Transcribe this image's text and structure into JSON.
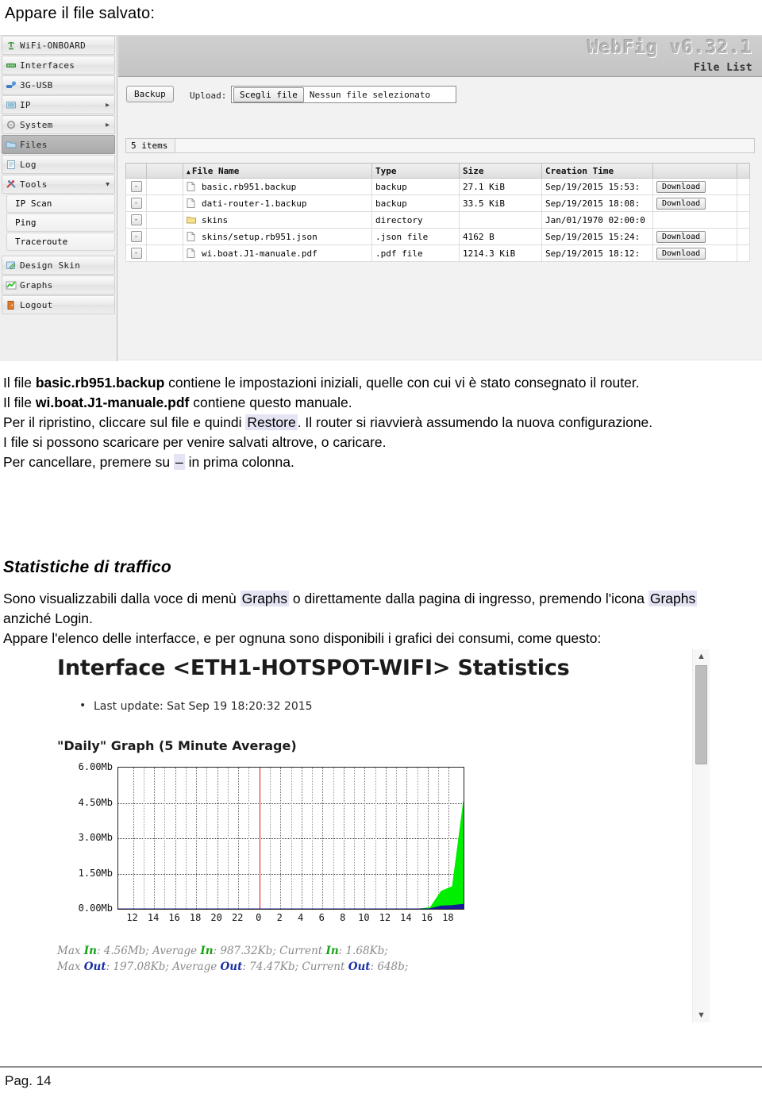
{
  "document": {
    "intro_line": "Appare il file salvato:",
    "page_label": "Pag. 14"
  },
  "webfig": {
    "brand": "WebFig v6.32.1",
    "page_title": "File List",
    "sidebar": {
      "items": [
        {
          "label": "WiFi-ONBOARD",
          "icon": "wifi-onboard-icon",
          "arrow": "",
          "selected": false
        },
        {
          "label": "Interfaces",
          "icon": "interfaces-icon",
          "arrow": "",
          "selected": false
        },
        {
          "label": "3G-USB",
          "icon": "usb-icon",
          "arrow": "",
          "selected": false
        },
        {
          "label": "IP",
          "icon": "ip-icon",
          "arrow": "▶",
          "selected": false
        },
        {
          "label": "System",
          "icon": "system-gear-icon",
          "arrow": "▶",
          "selected": false
        },
        {
          "label": "Files",
          "icon": "files-folder-icon",
          "arrow": "",
          "selected": true
        },
        {
          "label": "Log",
          "icon": "log-icon",
          "arrow": "",
          "selected": false
        },
        {
          "label": "Tools",
          "icon": "tools-icon",
          "arrow": "▼",
          "selected": false
        }
      ],
      "sub_items": [
        {
          "label": "IP Scan"
        },
        {
          "label": "Ping"
        },
        {
          "label": "Traceroute"
        }
      ],
      "items_after": [
        {
          "label": "Design Skin",
          "icon": "design-skin-icon"
        },
        {
          "label": "Graphs",
          "icon": "graphs-icon"
        },
        {
          "label": "Logout",
          "icon": "logout-icon"
        }
      ]
    },
    "toolbar": {
      "backup_label": "Backup",
      "upload_label": "Upload:",
      "choose_file_label": "Scegli file",
      "no_file_text": "Nessun file selezionato"
    },
    "items_count": "5 items",
    "table": {
      "headers": [
        "",
        "",
        "File Name",
        "Type",
        "Size",
        "Creation Time",
        "",
        ""
      ],
      "sort_column": "File Name",
      "sort_caret": "▲",
      "delete_label": "-",
      "download_label": "Download",
      "rows": [
        {
          "name": "basic.rb951.backup",
          "icon": "file-icon",
          "type": "backup",
          "size": "27.1 KiB",
          "time": "Sep/19/2015 15:53:",
          "download": true
        },
        {
          "name": "dati-router-1.backup",
          "icon": "file-icon",
          "type": "backup",
          "size": "33.5 KiB",
          "time": "Sep/19/2015 18:08:",
          "download": true
        },
        {
          "name": "skins",
          "icon": "folder-icon",
          "type": "directory",
          "size": "",
          "time": "Jan/01/1970 02:00:0",
          "download": false
        },
        {
          "name": "skins/setup.rb951.json",
          "icon": "file-icon",
          "type": ".json file",
          "size": "4162 B",
          "time": "Sep/19/2015 15:24:",
          "download": true
        },
        {
          "name": "wi.boat.J1-manuale.pdf",
          "icon": "file-icon",
          "type": ".pdf file",
          "size": "1214.3 KiB",
          "time": "Sep/19/2015 18:12:",
          "download": true
        }
      ]
    }
  },
  "text_block_1": {
    "line1_pre": "Il file ",
    "line1_bold": "basic.rb951.backup",
    "line1_post": " contiene le impostazioni iniziali, quelle con cui vi è stato consegnato il router.",
    "line2_pre": "Il file ",
    "line2_bold": "wi.boat.J1-manuale.pdf",
    "line2_post": " contiene questo manuale.",
    "line3_pre": "Per il ripristino, cliccare sul file e quindi ",
    "line3_hl": "Restore",
    "line3_post": ". Il router si riavvierà assumendo la nuova configurazione.",
    "line4": "I file si possono scaricare per venire salvati altrove, o caricare.",
    "line5_pre": "Per cancellare, premere su ",
    "line5_hl": "–",
    "line5_post": " in prima colonna."
  },
  "section_heading": "Statistiche di traffico",
  "text_block_2": {
    "line1_pre": "Sono visualizzabili dalla voce di menù ",
    "line1_hl": "Graphs",
    "line1_mid": " o direttamente dalla pagina di ingresso, premendo l'icona ",
    "line1_hl2": "Graphs",
    "line1_post": " anziché Login.",
    "line2": "Appare l'elenco delle interfacce, e per ognuna sono disponibili i grafici dei consumi, come questo:"
  },
  "graph_panel": {
    "title": "Interface <ETH1-HOTSPOT-WIFI> Statistics",
    "last_update": "Last update: Sat Sep 19 18:20:32 2015",
    "subtitle": "\"Daily\" Graph (5 Minute Average)",
    "stats_line1": {
      "max_label": "Max ",
      "max_dir": "In",
      "max_value": ": 4.56Mb; ",
      "avg_label": "Average ",
      "avg_dir": "In",
      "avg_value": ": 987.32Kb; ",
      "cur_label": "Current ",
      "cur_dir": "In",
      "cur_value": ": 1.68Kb;"
    },
    "stats_line2": {
      "max_label": "Max ",
      "max_dir": "Out",
      "max_value": ": 197.08Kb; ",
      "avg_label": "Average ",
      "avg_dir": "Out",
      "avg_value": ": 74.47Kb; ",
      "cur_label": "Current ",
      "cur_dir": "Out",
      "cur_value": ": 648b;"
    },
    "scrollbar": {
      "up_arrow": "▲",
      "down_arrow": "▼"
    }
  },
  "chart_data": {
    "type": "area",
    "title": "\"Daily\" Graph (5 Minute Average)",
    "xlabel": "",
    "ylabel": "",
    "ylim": [
      0,
      6.0
    ],
    "yticks": [
      "0.00Mb",
      "1.50Mb",
      "3.00Mb",
      "4.50Mb",
      "6.00Mb"
    ],
    "ytick_values": [
      0,
      1.5,
      3.0,
      4.5,
      6.0
    ],
    "xticks": [
      "12",
      "14",
      "16",
      "18",
      "20",
      "22",
      "0",
      "2",
      "4",
      "6",
      "8",
      "10",
      "12",
      "14",
      "16",
      "18"
    ],
    "grid": true,
    "now_marker_x": "0",
    "now_marker_color": "#dd1111",
    "series": [
      {
        "name": "In",
        "color": "#00ee00",
        "x": [
          11,
          12,
          13,
          14,
          15,
          16,
          17,
          18,
          19,
          20,
          21,
          22,
          23,
          0,
          1,
          2,
          3,
          4,
          5,
          6,
          7,
          8,
          9,
          10,
          11,
          12,
          13,
          14,
          15,
          16,
          17,
          18
        ],
        "values": [
          0,
          0,
          0,
          0,
          0,
          0,
          0,
          0,
          0,
          0,
          0,
          0,
          0,
          0,
          0,
          0,
          0,
          0,
          0,
          0,
          0,
          0,
          0,
          0,
          0,
          0,
          0,
          0,
          0.05,
          0.75,
          0.95,
          4.56
        ]
      },
      {
        "name": "Out",
        "color": "#1a1a99",
        "x": [
          11,
          12,
          13,
          14,
          15,
          16,
          17,
          18,
          19,
          20,
          21,
          22,
          23,
          0,
          1,
          2,
          3,
          4,
          5,
          6,
          7,
          8,
          9,
          10,
          11,
          12,
          13,
          14,
          15,
          16,
          17,
          18
        ],
        "values": [
          0,
          0,
          0,
          0,
          0,
          0,
          0,
          0,
          0,
          0,
          0,
          0,
          0,
          0,
          0,
          0,
          0,
          0,
          0,
          0,
          0,
          0,
          0,
          0,
          0,
          0,
          0,
          0,
          0.01,
          0.12,
          0.14,
          0.2
        ]
      }
    ]
  }
}
